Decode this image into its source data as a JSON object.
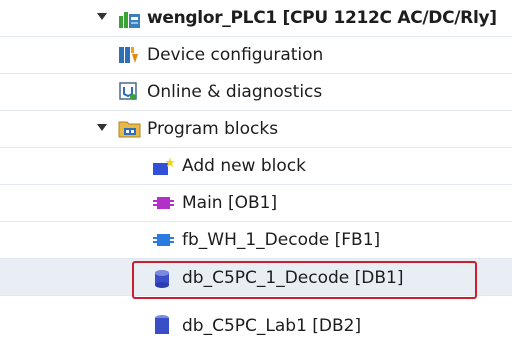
{
  "tree": {
    "items": [
      {
        "label": "wenglor_PLC1 [CPU 1212C AC/DC/Rly]",
        "icon": "plc-device-icon",
        "expanded": true
      },
      {
        "label": "Device configuration",
        "icon": "device-configuration-icon"
      },
      {
        "label": "Online & diagnostics",
        "icon": "online-diagnostics-icon"
      },
      {
        "label": "Program blocks",
        "icon": "folder-icon",
        "expanded": true
      },
      {
        "label": "Add new block",
        "icon": "add-new-block-icon"
      },
      {
        "label": "Main [OB1]",
        "icon": "organization-block-icon"
      },
      {
        "label": "fb_WH_1_Decode [FB1]",
        "icon": "function-block-icon"
      },
      {
        "label": "db_C5PC_1_Decode [DB1]",
        "icon": "data-block-icon",
        "highlighted": true
      },
      {
        "label": "db_C5PC_Lab1 [DB2]",
        "icon": "data-block-icon"
      }
    ]
  },
  "colors": {
    "highlight_border": "#c8202f",
    "row_divider": "#e3e8ee"
  }
}
